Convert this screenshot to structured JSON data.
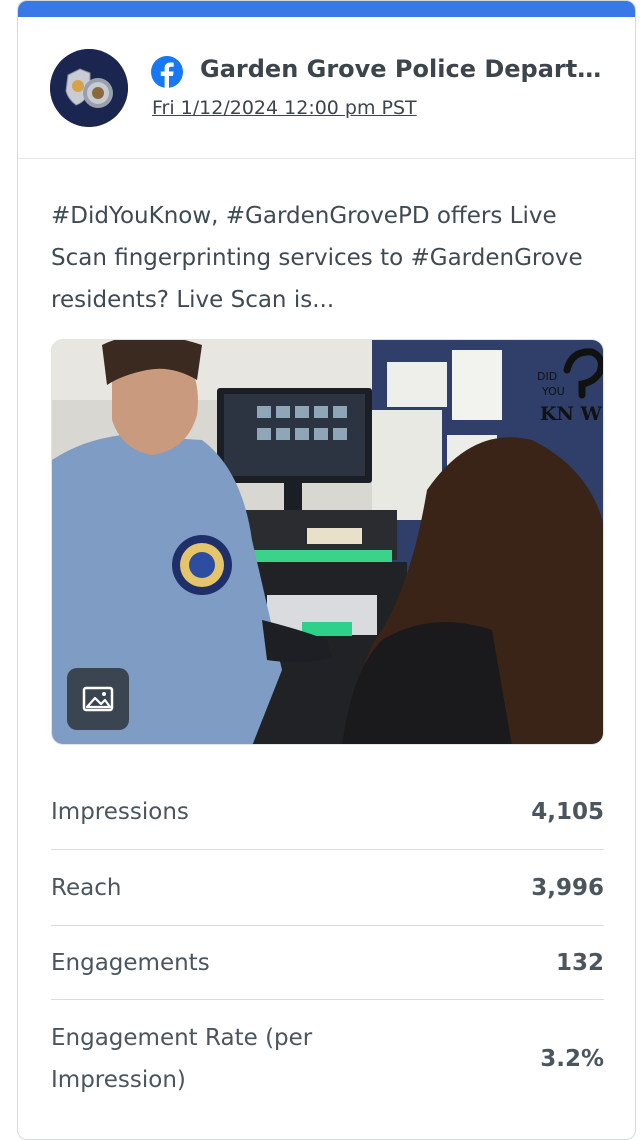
{
  "post": {
    "page_name": "Garden Grove Police Department",
    "date": "Fri 1/12/2024 12:00 pm PST",
    "network_icon": "facebook-icon",
    "text": "#DidYouKnow, #GardenGrovePD offers Live Scan fingerprinting services to #GardenGrove residents? Live Scan is...",
    "media_icon": "image-icon",
    "media_overlay_text": [
      "DID",
      "YOU",
      "KN",
      "W"
    ]
  },
  "stats": [
    {
      "label": "Impressions",
      "value": "4,105"
    },
    {
      "label": "Reach",
      "value": "3,996"
    },
    {
      "label": "Engagements",
      "value": "132"
    },
    {
      "label": "Engagement Rate (per Impression)",
      "value": "3.2%"
    }
  ],
  "colors": {
    "accent_bar": "#3b78e7",
    "facebook_blue": "#1877f2"
  }
}
